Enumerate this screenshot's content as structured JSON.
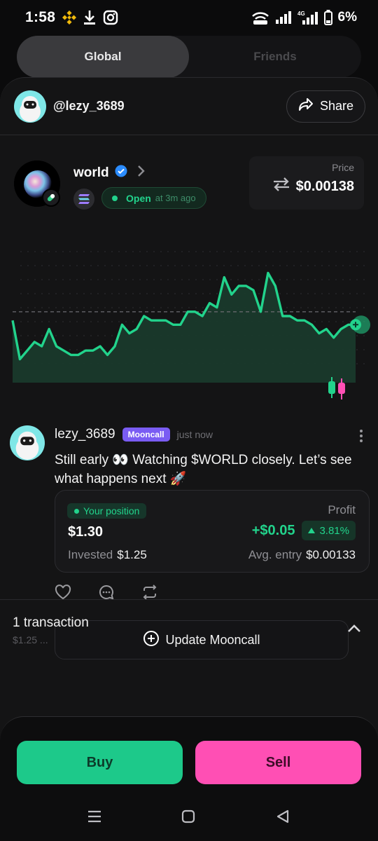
{
  "status_bar": {
    "time": "1:58",
    "battery": "6%"
  },
  "tabs": [
    {
      "label": "Global",
      "active": true
    },
    {
      "label": "Friends",
      "active": false
    }
  ],
  "header": {
    "handle": "@lezy_3689",
    "share_label": "Share"
  },
  "token": {
    "name": "world",
    "status": "Open",
    "opened_ago": "at 3m ago",
    "price_label": "Price",
    "price": "$0.00138"
  },
  "chart_data": {
    "type": "area",
    "series": [
      {
        "values": [
          0.000136,
          0.000127,
          0.000129,
          0.000131,
          0.00013,
          0.000134,
          0.00013,
          0.000129,
          0.000128,
          0.000128,
          0.000129,
          0.000129,
          0.00013,
          0.000128,
          0.00013,
          0.000135,
          0.000133,
          0.000134,
          0.000137,
          0.000136,
          0.000136,
          0.000136,
          0.000135,
          0.000135,
          0.000138,
          0.000138,
          0.000137,
          0.00014,
          0.000139,
          0.000146,
          0.000142,
          0.000144,
          0.000144,
          0.000143,
          0.000138,
          0.000147,
          0.000144,
          0.000137,
          0.000137,
          0.000136,
          0.000136,
          0.000135,
          0.000133,
          0.000134,
          0.000132,
          0.000134,
          0.000135,
          0.000135
        ]
      }
    ],
    "reference_line": 0.000138,
    "grid": true,
    "colors": {
      "line": "#22d38c",
      "fill": "#1d3a2e"
    }
  },
  "post": {
    "user": "lezy_3689",
    "badge": "Mooncall",
    "time": "just now",
    "text": "Still early 👀 Watching $WORLD closely. Let’s see what happens next 🚀"
  },
  "position": {
    "label": "Your position",
    "amount": "$1.30",
    "invested_label": "Invested",
    "invested": "$1.25",
    "profit_label": "Profit",
    "profit": "+$0.05",
    "profit_pct": "3.81%",
    "avg_label": "Avg. entry",
    "avg_entry": "$0.00133"
  },
  "update_label": "Update Mooncall",
  "transactions": {
    "title": "1 transaction",
    "subtitle": "$1.25 ..."
  },
  "bottom": {
    "buy_label": "Buy",
    "sell_label": "Sell"
  },
  "colors": {
    "accent_green": "#22d38c",
    "buy": "#1dc98a",
    "sell": "#ff4fb4",
    "badge_purple": "#7a5cf3"
  },
  "icons": [
    "binance-icon",
    "download-icon",
    "instagram-icon",
    "hotspot-icon",
    "signal-icon",
    "battery-icon",
    "share-icon",
    "verified-icon",
    "chevron-right-icon",
    "solana-icon",
    "swap-icon",
    "candles-icon",
    "more-icon",
    "heart-icon",
    "comment-icon",
    "repost-icon",
    "plus-circle-icon",
    "chevron-up-icon",
    "menu-nav-icon",
    "home-nav-icon",
    "back-nav-icon"
  ]
}
